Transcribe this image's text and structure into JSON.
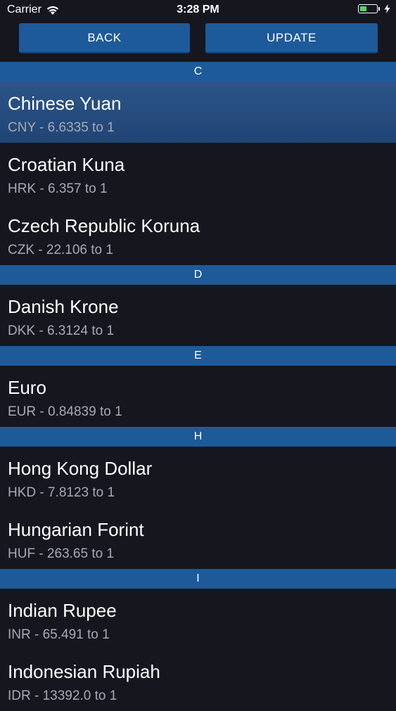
{
  "status_bar": {
    "carrier": "Carrier",
    "time": "3:28 PM",
    "battery_level": 0.45
  },
  "toolbar": {
    "back_label": "BACK",
    "update_label": "UPDATE"
  },
  "colors": {
    "background": "#16161f",
    "accent": "#1d5a9a",
    "selected_row": "#2c5488",
    "battery_green": "#4cd964"
  },
  "sections": [
    {
      "letter": "C",
      "items": [
        {
          "name": "Chinese Yuan",
          "rate": "CNY - 6.6335 to 1",
          "selected": true
        },
        {
          "name": "Croatian Kuna",
          "rate": "HRK - 6.357 to 1"
        },
        {
          "name": "Czech Republic Koruna",
          "rate": "CZK - 22.106 to 1"
        }
      ]
    },
    {
      "letter": "D",
      "items": [
        {
          "name": "Danish Krone",
          "rate": "DKK - 6.3124 to 1"
        }
      ]
    },
    {
      "letter": "E",
      "items": [
        {
          "name": "Euro",
          "rate": "EUR - 0.84839 to 1"
        }
      ]
    },
    {
      "letter": "H",
      "items": [
        {
          "name": "Hong Kong Dollar",
          "rate": "HKD - 7.8123 to 1"
        },
        {
          "name": "Hungarian Forint",
          "rate": "HUF - 263.65 to 1"
        }
      ]
    },
    {
      "letter": "I",
      "items": [
        {
          "name": "Indian Rupee",
          "rate": "INR - 65.491 to 1"
        },
        {
          "name": "Indonesian Rupiah",
          "rate": "IDR - 13392.0 to 1"
        }
      ]
    }
  ]
}
